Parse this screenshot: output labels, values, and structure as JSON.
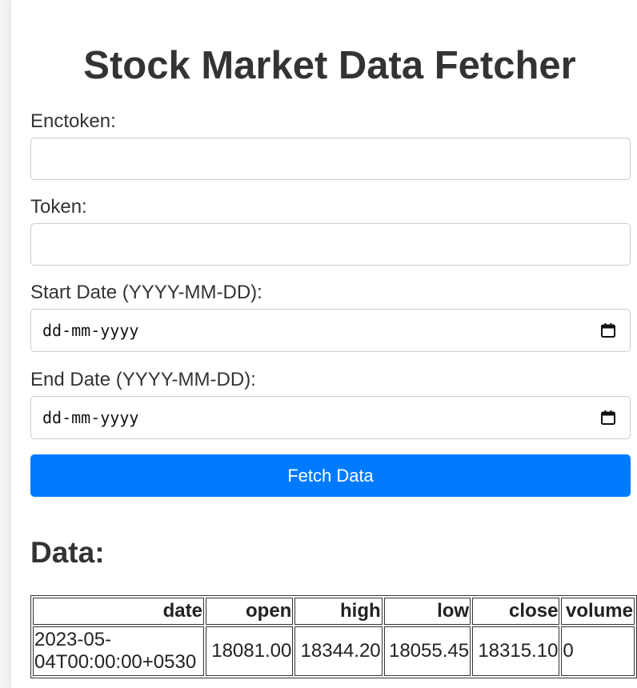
{
  "page": {
    "title": "Stock Market Data Fetcher"
  },
  "form": {
    "enctoken_label": "Enctoken:",
    "enctoken_value": "",
    "token_label": "Token:",
    "token_value": "",
    "start_date_label": "Start Date (YYYY-MM-DD):",
    "start_date_placeholder": "dd-mm-yyyy",
    "end_date_label": "End Date (YYYY-MM-DD):",
    "end_date_placeholder": "dd-mm-yyyy",
    "fetch_button_label": "Fetch Data"
  },
  "data_section": {
    "title": "Data:",
    "columns": [
      "date",
      "open",
      "high",
      "low",
      "close",
      "volume"
    ],
    "rows": [
      {
        "date_line1": "2023-05-",
        "date_line2": "04T00:00:00+0530",
        "open": "18081.00",
        "high": "18344.20",
        "low": "18055.45",
        "close": "18315.10",
        "volume": "0"
      }
    ]
  },
  "icons": {
    "start_date_calendar": "calendar-icon",
    "end_date_calendar": "calendar-icon"
  },
  "colors": {
    "primary_button": "#007bff",
    "text": "#333333",
    "border": "#cccccc",
    "background": "#f4f4f4"
  }
}
